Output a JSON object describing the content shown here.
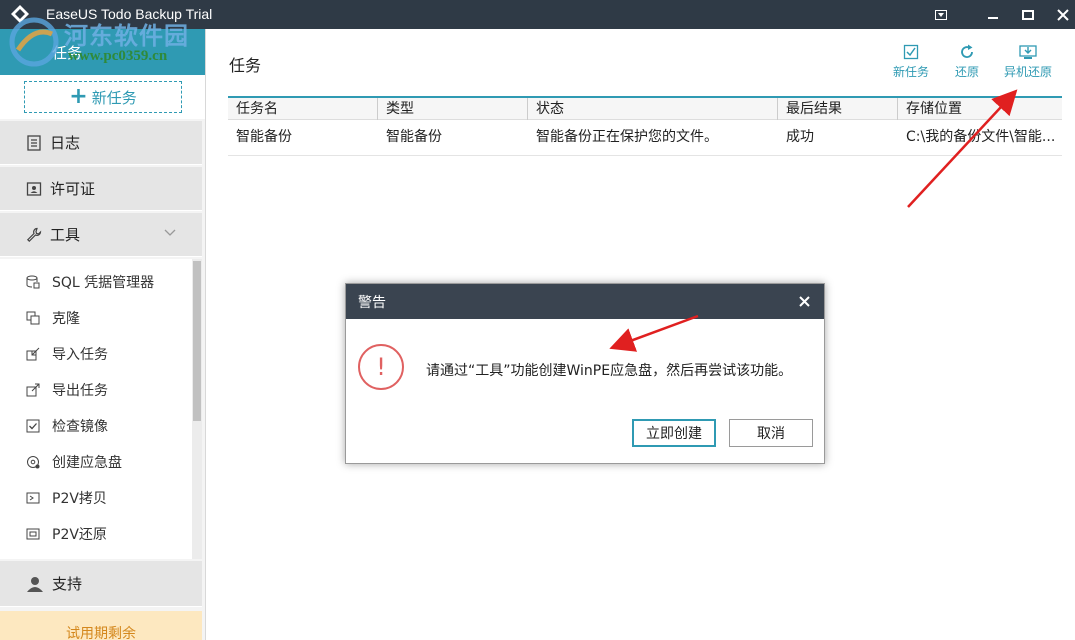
{
  "window": {
    "title": "EaseUS Todo Backup Trial"
  },
  "watermark": {
    "title": "河东软件园",
    "url": "www.pc0359.cn"
  },
  "sidebar": {
    "tasks_label": "任务",
    "new_task_label": "新任务",
    "groups": {
      "log": "日志",
      "license": "许可证",
      "tools": "工具",
      "support": "支持"
    },
    "tool_items": [
      "SQL 凭据管理器",
      "克隆",
      "导入任务",
      "导出任务",
      "检查镜像",
      "创建应急盘",
      "P2V拷贝",
      "P2V还原"
    ],
    "trial": "试用期剩余"
  },
  "main": {
    "title": "任务",
    "toolbar": {
      "new_task": "新任务",
      "restore": "还原",
      "remote_restore": "异机还原"
    },
    "table": {
      "columns": [
        "任务名",
        "类型",
        "状态",
        "最后结果",
        "存储位置"
      ],
      "rows": [
        [
          "智能备份",
          "智能备份",
          "智能备份正在保护您的文件。",
          "成功",
          "C:\\我的备份文件\\智能..."
        ]
      ]
    }
  },
  "dialog": {
    "title": "警告",
    "icon_glyph": "!",
    "message": "请通过“工具”功能创建WinPE应急盘，然后再尝试该功能。",
    "confirm_label": "立即创建",
    "cancel_label": "取消"
  },
  "colors": {
    "accent": "#2f9ab3",
    "titlebar": "#2f3a46",
    "warning": "#e06161",
    "arrow": "#e02020"
  }
}
